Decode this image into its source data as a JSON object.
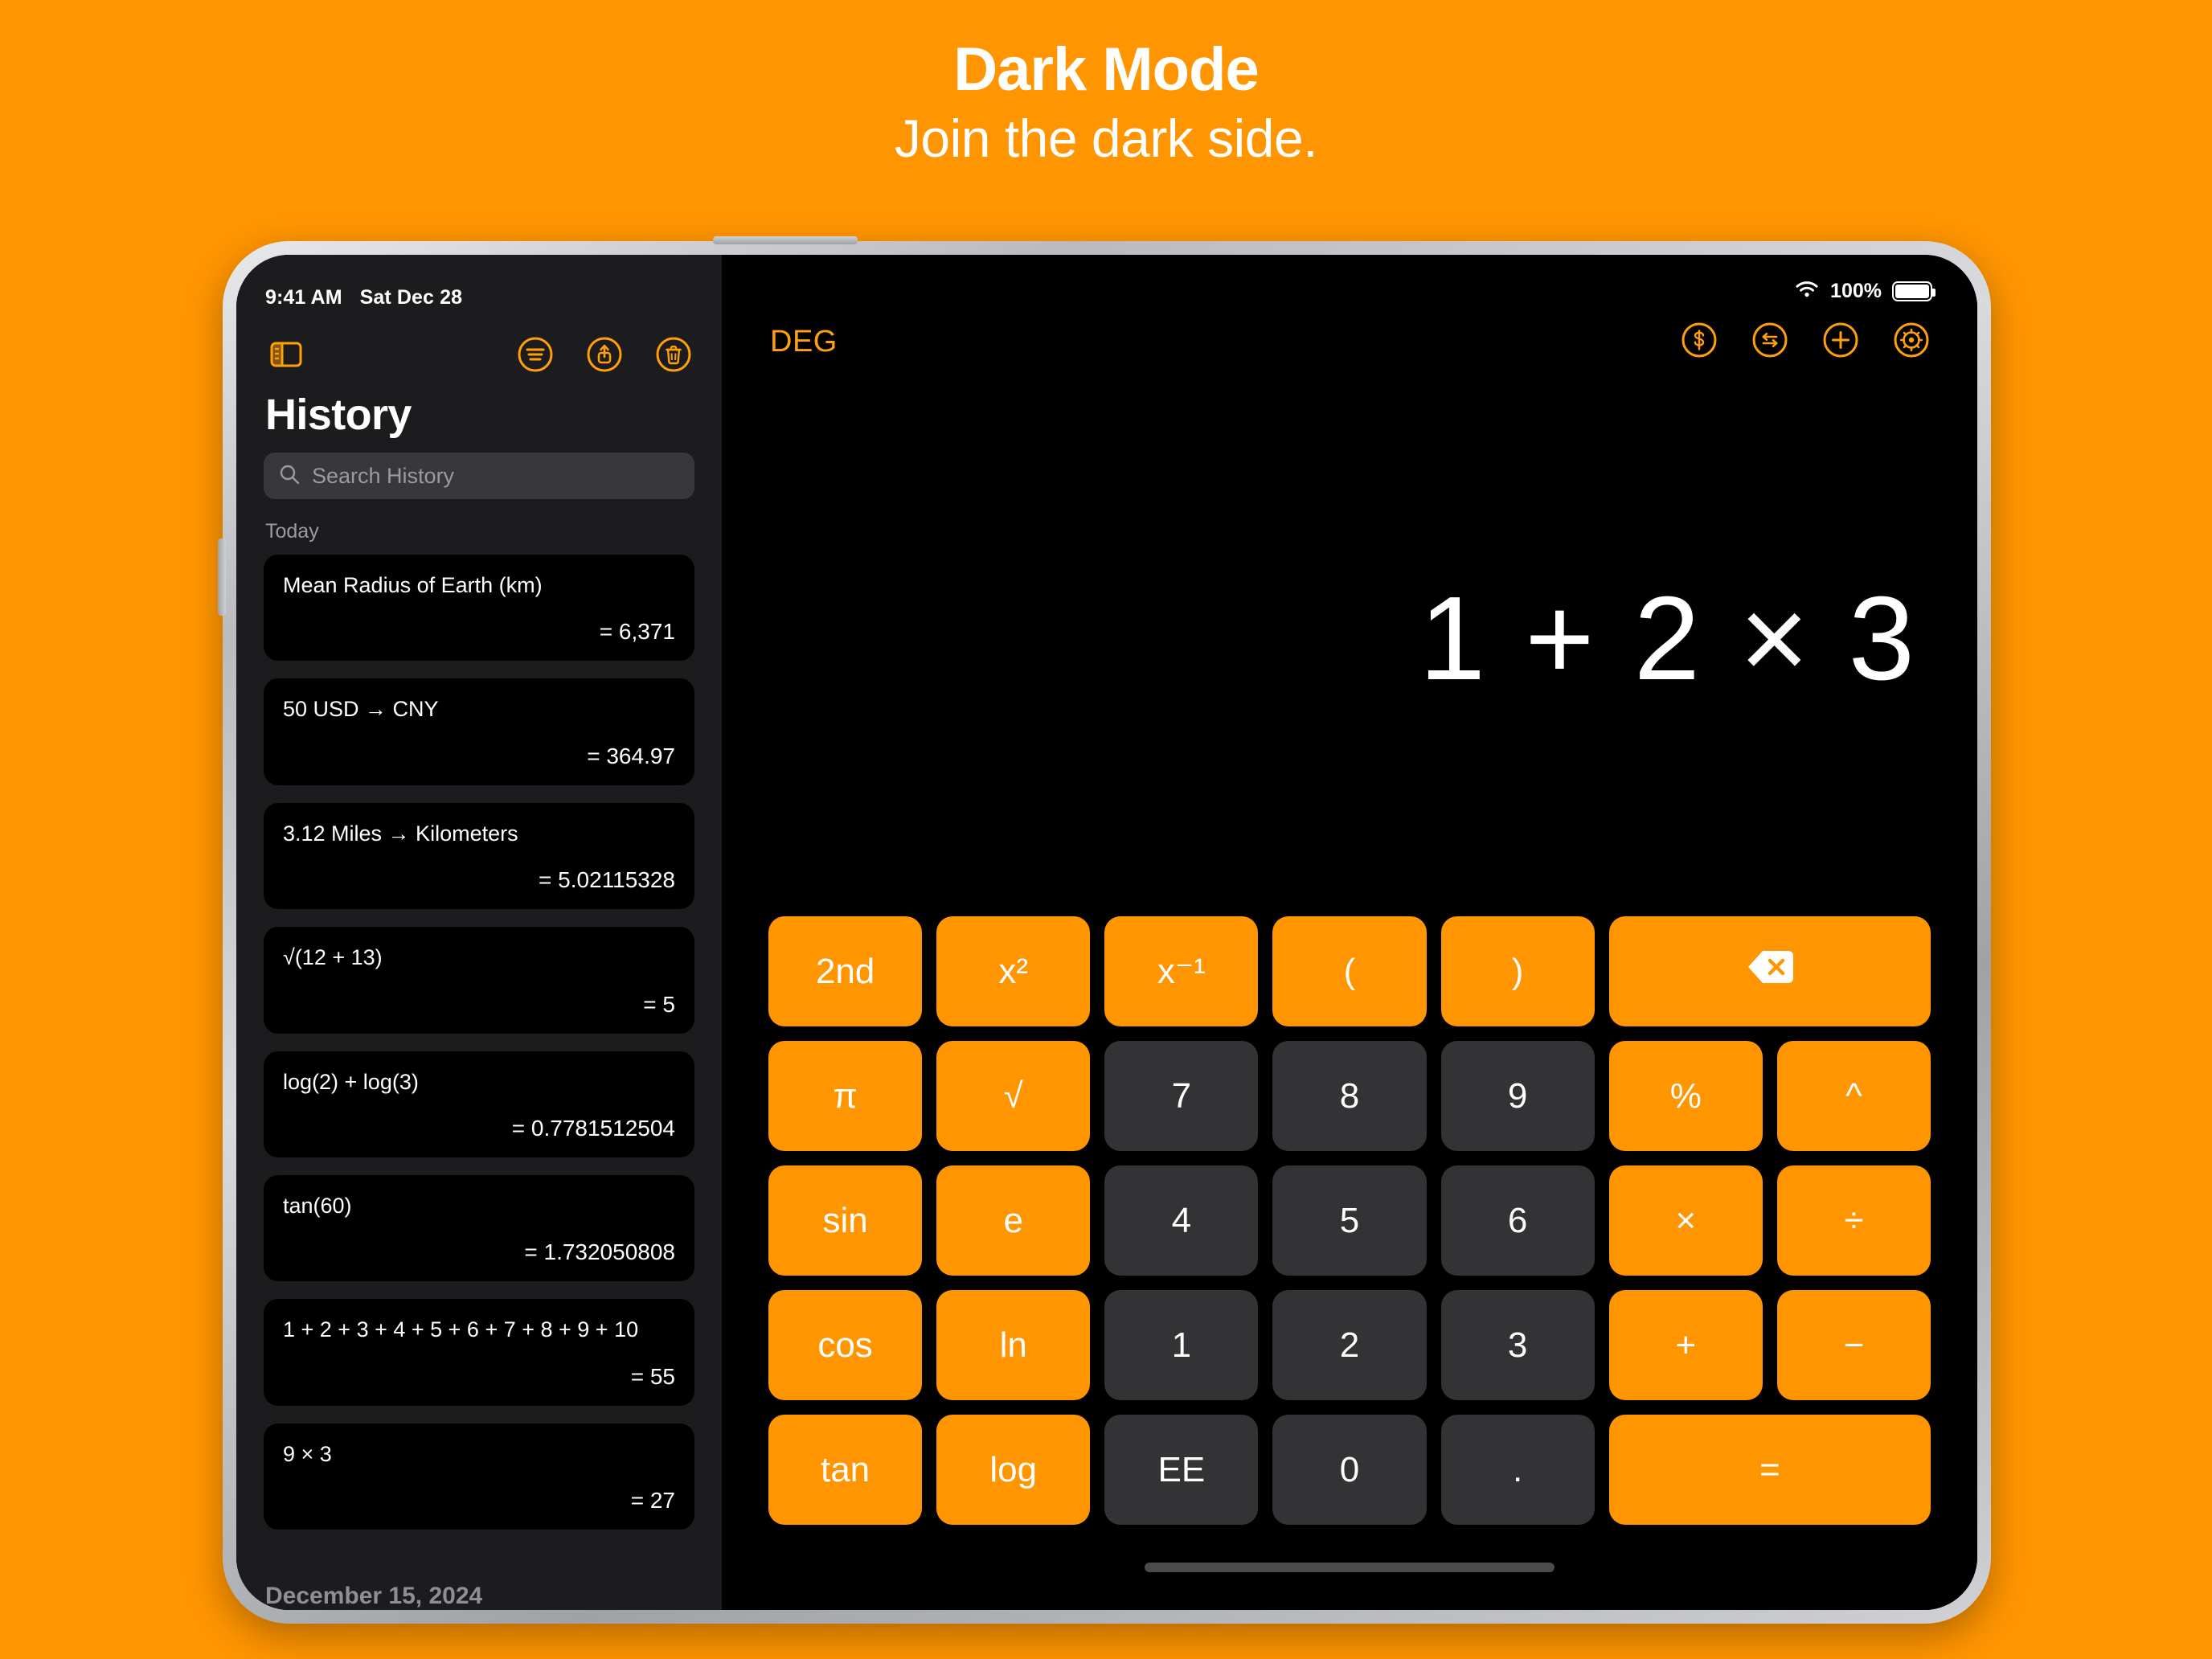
{
  "promo": {
    "title": "Dark Mode",
    "subtitle": "Join the dark side."
  },
  "colors": {
    "background_orange": "#FF9500",
    "accent_orange": "#FF9F0A",
    "key_orange": "#FF9500",
    "key_dark": "#333336",
    "sidebar_bg": "#1C1C1E",
    "screen_bg": "#000000"
  },
  "status_bar": {
    "time": "9:41 AM",
    "date": "Sat Dec 28",
    "wifi_icon": "wifi-icon",
    "battery_percent": "100%",
    "battery_icon": "battery-full-icon"
  },
  "sidebar": {
    "toolbar": {
      "sidebar_toggle_icon": "sidebar-toggle-icon",
      "filter_icon": "filter-icon",
      "share_icon": "share-icon",
      "trash_icon": "trash-icon"
    },
    "title": "History",
    "search": {
      "placeholder": "Search History",
      "icon": "search-icon"
    },
    "section_label": "Today",
    "items": [
      {
        "expression": "Mean Radius of Earth (km)",
        "result": "= 6,371"
      },
      {
        "expression": "50 USD → CNY",
        "result": "= 364.97"
      },
      {
        "expression": "3.12 Miles → Kilometers",
        "result": "= 5.02115328"
      },
      {
        "expression": "√(12 + 13)",
        "result": "= 5"
      },
      {
        "expression": "log(2) + log(3)",
        "result": "= 0.7781512504"
      },
      {
        "expression": "tan(60)",
        "result": "= 1.732050808"
      },
      {
        "expression": "1 + 2 + 3 + 4 + 5 + 6 + 7 + 8 + 9 + 10",
        "result": "= 55"
      },
      {
        "expression": "9 × 3",
        "result": "= 27"
      }
    ],
    "next_date_label": "December 15, 2024"
  },
  "calculator": {
    "angle_mode": "DEG",
    "toolbar": {
      "currency_icon": "dollar-circle-icon",
      "convert_icon": "convert-arrows-circle-icon",
      "add_icon": "plus-circle-icon",
      "settings_icon": "gear-circle-icon"
    },
    "display_expression": "1 + 2 × 3",
    "keypad": {
      "rows": [
        [
          {
            "label": "2nd",
            "style": "orange",
            "span": 1,
            "name": "key-2nd"
          },
          {
            "label": "x²",
            "style": "orange",
            "span": 1,
            "name": "key-x-squared"
          },
          {
            "label": "x⁻¹",
            "style": "orange",
            "span": 1,
            "name": "key-x-inverse"
          },
          {
            "label": "(",
            "style": "orange",
            "span": 1,
            "name": "key-open-paren"
          },
          {
            "label": ")",
            "style": "orange",
            "span": 1,
            "name": "key-close-paren"
          },
          {
            "label": "",
            "style": "orange",
            "span": 2,
            "name": "key-backspace",
            "icon": "backspace-icon"
          }
        ],
        [
          {
            "label": "π",
            "style": "orange",
            "span": 1,
            "name": "key-pi"
          },
          {
            "label": "√",
            "style": "orange",
            "span": 1,
            "name": "key-square-root"
          },
          {
            "label": "7",
            "style": "dark",
            "span": 1,
            "name": "key-7"
          },
          {
            "label": "8",
            "style": "dark",
            "span": 1,
            "name": "key-8"
          },
          {
            "label": "9",
            "style": "dark",
            "span": 1,
            "name": "key-9"
          },
          {
            "label": "%",
            "style": "orange",
            "span": 1,
            "name": "key-percent"
          },
          {
            "label": "^",
            "style": "orange",
            "span": 1,
            "name": "key-power"
          }
        ],
        [
          {
            "label": "sin",
            "style": "orange",
            "span": 1,
            "name": "key-sin"
          },
          {
            "label": "e",
            "style": "orange",
            "span": 1,
            "name": "key-e"
          },
          {
            "label": "4",
            "style": "dark",
            "span": 1,
            "name": "key-4"
          },
          {
            "label": "5",
            "style": "dark",
            "span": 1,
            "name": "key-5"
          },
          {
            "label": "6",
            "style": "dark",
            "span": 1,
            "name": "key-6"
          },
          {
            "label": "×",
            "style": "orange",
            "span": 1,
            "name": "key-multiply"
          },
          {
            "label": "÷",
            "style": "orange",
            "span": 1,
            "name": "key-divide"
          }
        ],
        [
          {
            "label": "cos",
            "style": "orange",
            "span": 1,
            "name": "key-cos"
          },
          {
            "label": "ln",
            "style": "orange",
            "span": 1,
            "name": "key-ln"
          },
          {
            "label": "1",
            "style": "dark",
            "span": 1,
            "name": "key-1"
          },
          {
            "label": "2",
            "style": "dark",
            "span": 1,
            "name": "key-2"
          },
          {
            "label": "3",
            "style": "dark",
            "span": 1,
            "name": "key-3"
          },
          {
            "label": "+",
            "style": "orange",
            "span": 1,
            "name": "key-plus"
          },
          {
            "label": "−",
            "style": "orange",
            "span": 1,
            "name": "key-minus"
          }
        ],
        [
          {
            "label": "tan",
            "style": "orange",
            "span": 1,
            "name": "key-tan"
          },
          {
            "label": "log",
            "style": "orange",
            "span": 1,
            "name": "key-log"
          },
          {
            "label": "EE",
            "style": "dark",
            "span": 1,
            "name": "key-ee"
          },
          {
            "label": "0",
            "style": "dark",
            "span": 1,
            "name": "key-0"
          },
          {
            "label": ".",
            "style": "dark",
            "span": 1,
            "name": "key-decimal"
          },
          {
            "label": "=",
            "style": "orange",
            "span": 2,
            "name": "key-equals"
          }
        ]
      ]
    }
  }
}
